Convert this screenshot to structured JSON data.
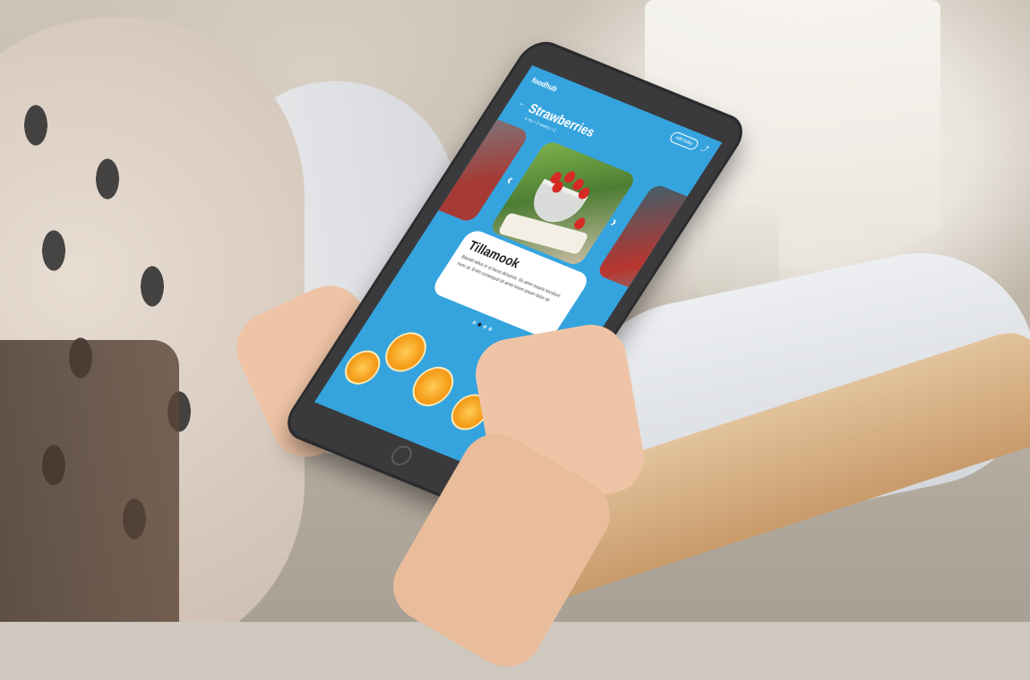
{
  "scene": {
    "description_tag": "photo-of-person-holding-tablet",
    "colors": {
      "screen": "#35a4de",
      "bezel": "#3a3a3c",
      "card": "#ffffff"
    }
  },
  "tablet_app": {
    "logo": "foodhub",
    "header_button": "add today",
    "title": "Strawberries",
    "subtitle": "4 ms • 3 weeks • 2",
    "card_title": "Tillamook",
    "card_description": "Blandit tellus in ut lacus dictumst. Sit amet mauris tincidunt nunc at. Enim consequat sit amet lorem ipsum dolor sit.",
    "carousel_prev_icon": "chevron-left-icon",
    "carousel_next_icon": "chevron-right-icon",
    "back_icon": "arrow-left-icon",
    "share_icon": "share-icon",
    "page_dots": {
      "count": 4,
      "active": 2
    }
  }
}
